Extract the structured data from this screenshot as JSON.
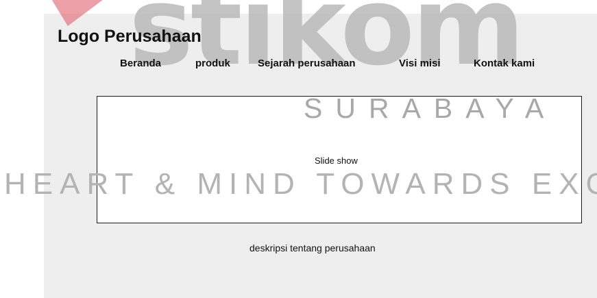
{
  "header": {
    "logo_text": "Logo Perusahaan"
  },
  "nav": {
    "items": [
      {
        "label": "Beranda"
      },
      {
        "label": "produk"
      },
      {
        "label": "Sejarah perusahaan"
      },
      {
        "label": "Visi misi"
      },
      {
        "label": "Kontak kami"
      }
    ]
  },
  "main": {
    "slideshow_label": "Slide show",
    "description": "deskripsi tentang perusahaan"
  },
  "watermark": {
    "brand": "stikom",
    "city": "SURABAYA",
    "tagline": "HEART & MIND TOWARDS EXCELLENCE"
  },
  "colors": {
    "panel_background": "#eeeeee",
    "text": "#111111",
    "watermark_gray": "#bdbdbd",
    "watermark_accent": "#e26b78"
  }
}
